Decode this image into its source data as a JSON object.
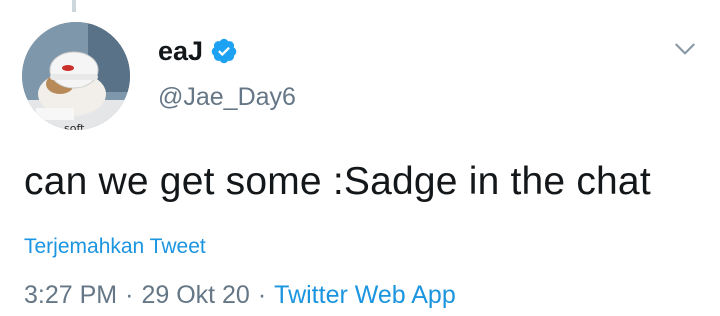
{
  "tweet": {
    "author": {
      "display_name": "eaJ",
      "handle": "@Jae_Day6",
      "verified": true,
      "avatar_caption": "soft"
    },
    "text": "can we get some :Sadge in the chat",
    "translate_label": "Terjemahkan Tweet",
    "time": "3:27 PM",
    "date": "29 Okt 20",
    "separator": "·",
    "source": "Twitter Web App"
  },
  "colors": {
    "link": "#1b95e0",
    "verified_badge": "#1da1f2",
    "secondary_text": "#657786",
    "primary_text": "#14171a"
  },
  "icons": {
    "verified": "verified-badge-icon",
    "more": "chevron-down-icon"
  }
}
